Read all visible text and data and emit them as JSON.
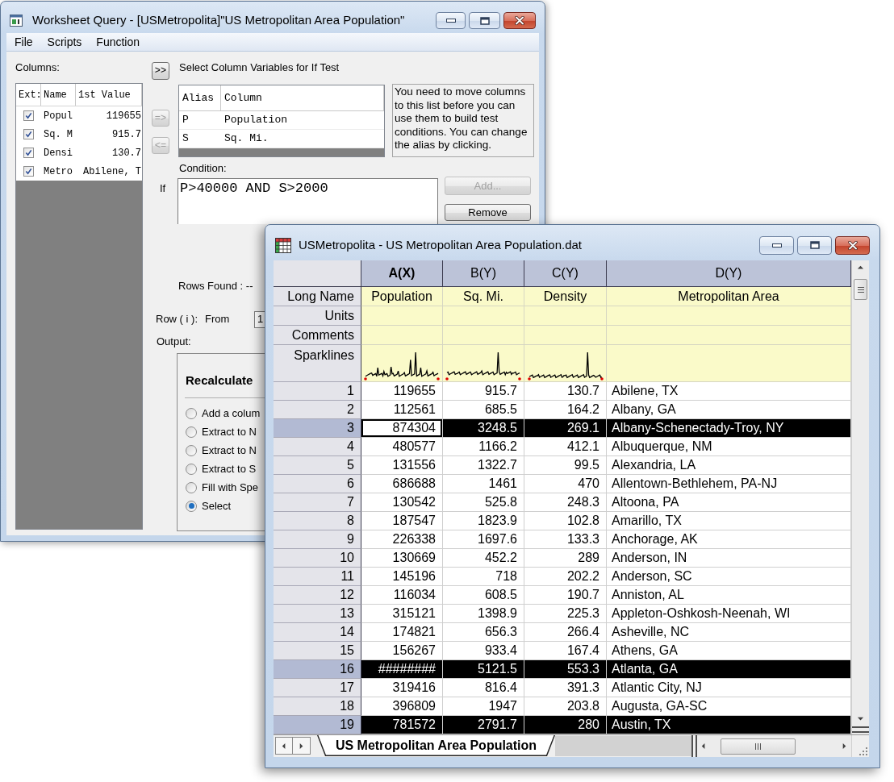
{
  "query_window": {
    "title": "Worksheet Query - [USMetropolita]\"US Metropolitan Area Population\"",
    "menu": [
      "File",
      "Scripts",
      "Function"
    ],
    "columns_label": "Columns:",
    "columns_list": {
      "headers": [
        "Ext:",
        "Name",
        "1st Value"
      ],
      "rows": [
        {
          "checked": true,
          "name": "Popul",
          "first_value": "119655"
        },
        {
          "checked": true,
          "name": "Sq. M",
          "first_value": "915.7"
        },
        {
          "checked": true,
          "name": "Densi",
          "first_value": "130.7"
        },
        {
          "checked": true,
          "name": "Metro",
          "first_value": "Abilene, T"
        }
      ]
    },
    "move_buttons": [
      {
        "label": ">>",
        "disabled": false
      },
      {
        "label": "=>",
        "disabled": true
      },
      {
        "label": "<=",
        "disabled": true
      }
    ],
    "variables_title": "Select Column Variables for If Test",
    "alias_table": {
      "headers": [
        "Alias",
        "Column"
      ],
      "rows": [
        {
          "alias": "P",
          "column": "Population"
        },
        {
          "alias": "S",
          "column": "Sq. Mi."
        }
      ]
    },
    "hint": "You need to move columns to this list before you can use them to build test conditions. You can change the alias by clicking.",
    "condition_label": "Condition:",
    "if_label": "If",
    "condition": "P>40000 AND S>2000",
    "condition_buttons": [
      {
        "label": "Add...",
        "disabled": true
      },
      {
        "label": "Remove",
        "disabled": false
      }
    ],
    "rows_found": "Rows Found : --",
    "row_label": "Row ( i ):",
    "from_label": "From",
    "from_value": "1",
    "output_label": "Output:",
    "output": {
      "title": "Recalculate",
      "options": [
        {
          "label": "Add a colum",
          "selected": false
        },
        {
          "label": "Extract to N",
          "selected": false
        },
        {
          "label": "Extract to N",
          "selected": false
        },
        {
          "label": "Extract to S",
          "selected": false
        },
        {
          "label": "Fill with Spe",
          "selected": false
        },
        {
          "label": "Select",
          "selected": true
        }
      ]
    }
  },
  "worksheet_window": {
    "title": "USMetropolita - US Metropolitan Area Population.dat",
    "columns": [
      {
        "label": "A(X)",
        "active": true,
        "sparkline": true
      },
      {
        "label": "B(Y)",
        "active": false,
        "sparkline": true
      },
      {
        "label": "C(Y)",
        "active": false,
        "sparkline": true
      },
      {
        "label": "D(Y)",
        "active": false,
        "sparkline": false
      }
    ],
    "label_rows": [
      {
        "kind": "text",
        "label": "Long Name",
        "values": [
          "Population",
          "Sq. Mi.",
          "Density",
          "Metropolitan Area"
        ]
      },
      {
        "kind": "text",
        "label": "Units"
      },
      {
        "kind": "text",
        "label": "Comments"
      },
      {
        "kind": "sparkline",
        "label": "Sparklines"
      }
    ],
    "rows": [
      {
        "number": "1",
        "cells": [
          "119655",
          "915.7",
          "130.7",
          "Abilene, TX"
        ],
        "selected": false,
        "active": false
      },
      {
        "number": "2",
        "cells": [
          "112561",
          "685.5",
          "164.2",
          "Albany, GA"
        ],
        "selected": false,
        "active": false
      },
      {
        "number": "3",
        "cells": [
          "874304",
          "3248.5",
          "269.1",
          "Albany-Schenectady-Troy, NY"
        ],
        "selected": true,
        "active": true
      },
      {
        "number": "4",
        "cells": [
          "480577",
          "1166.2",
          "412.1",
          "Albuquerque, NM"
        ],
        "selected": false,
        "active": false
      },
      {
        "number": "5",
        "cells": [
          "131556",
          "1322.7",
          "99.5",
          "Alexandria, LA"
        ],
        "selected": false,
        "active": false
      },
      {
        "number": "6",
        "cells": [
          "686688",
          "1461",
          "470",
          "Allentown-Bethlehem, PA-NJ"
        ],
        "selected": false,
        "active": false
      },
      {
        "number": "7",
        "cells": [
          "130542",
          "525.8",
          "248.3",
          "Altoona, PA"
        ],
        "selected": false,
        "active": false
      },
      {
        "number": "8",
        "cells": [
          "187547",
          "1823.9",
          "102.8",
          "Amarillo, TX"
        ],
        "selected": false,
        "active": false
      },
      {
        "number": "9",
        "cells": [
          "226338",
          "1697.6",
          "133.3",
          "Anchorage, AK"
        ],
        "selected": false,
        "active": false
      },
      {
        "number": "10",
        "cells": [
          "130669",
          "452.2",
          "289",
          "Anderson, IN"
        ],
        "selected": false,
        "active": false
      },
      {
        "number": "11",
        "cells": [
          "145196",
          "718",
          "202.2",
          "Anderson, SC"
        ],
        "selected": false,
        "active": false
      },
      {
        "number": "12",
        "cells": [
          "116034",
          "608.5",
          "190.7",
          "Anniston, AL"
        ],
        "selected": false,
        "active": false
      },
      {
        "number": "13",
        "cells": [
          "315121",
          "1398.9",
          "225.3",
          "Appleton-Oshkosh-Neenah, WI"
        ],
        "selected": false,
        "active": false
      },
      {
        "number": "14",
        "cells": [
          "174821",
          "656.3",
          "266.4",
          "Asheville, NC"
        ],
        "selected": false,
        "active": false
      },
      {
        "number": "15",
        "cells": [
          "156267",
          "933.4",
          "167.4",
          "Athens, GA"
        ],
        "selected": false,
        "active": false
      },
      {
        "number": "16",
        "cells": [
          "########",
          "5121.5",
          "553.3",
          "Atlanta, GA"
        ],
        "selected": true,
        "active": false
      },
      {
        "number": "17",
        "cells": [
          "319416",
          "816.4",
          "391.3",
          "Atlantic City, NJ"
        ],
        "selected": false,
        "active": false
      },
      {
        "number": "18",
        "cells": [
          "396809",
          "1947",
          "203.8",
          "Augusta, GA-SC"
        ],
        "selected": false,
        "active": false
      },
      {
        "number": "19",
        "cells": [
          "781572",
          "2791.7",
          "280",
          "Austin, TX"
        ],
        "selected": true,
        "active": false
      }
    ],
    "sheet_tab": "US Metropolitan Area Population"
  }
}
